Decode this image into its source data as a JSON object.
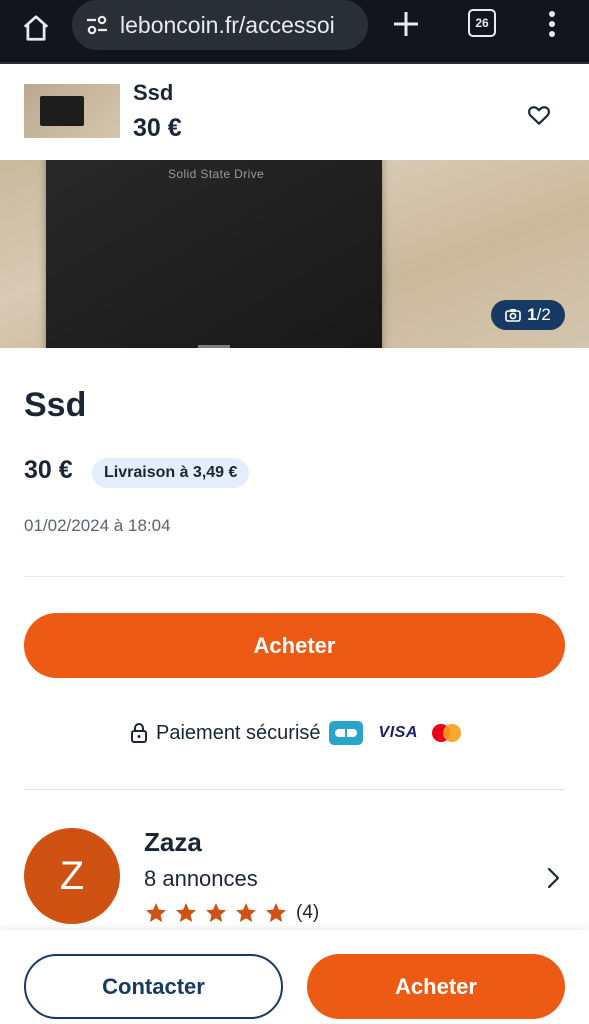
{
  "browser": {
    "url": "leboncoin.fr/accessoi",
    "tab_count": "26"
  },
  "sticky_header": {
    "title": "Ssd",
    "price": "30 €"
  },
  "photo": {
    "drive_label": "Solid State Drive",
    "counter_current": "1",
    "counter_total": "/2"
  },
  "listing": {
    "title": "Ssd",
    "price": "30 €",
    "shipping_badge": "Livraison à 3,49 €",
    "date": "01/02/2024 à 18:04",
    "buy_label": "Acheter"
  },
  "payment": {
    "secure_label": "Paiement sécurisé",
    "visa_label": "VISA"
  },
  "seller": {
    "initial": "Z",
    "name": "Zaza",
    "ads_count": "8 annonces",
    "rating_stars": 5,
    "rating_count": "(4)"
  },
  "bottom_bar": {
    "contact_label": "Contacter",
    "buy_label": "Acheter"
  },
  "colors": {
    "accent_orange": "#ec5a13",
    "brand_blue": "#163a63",
    "star_color": "#cf5212"
  }
}
